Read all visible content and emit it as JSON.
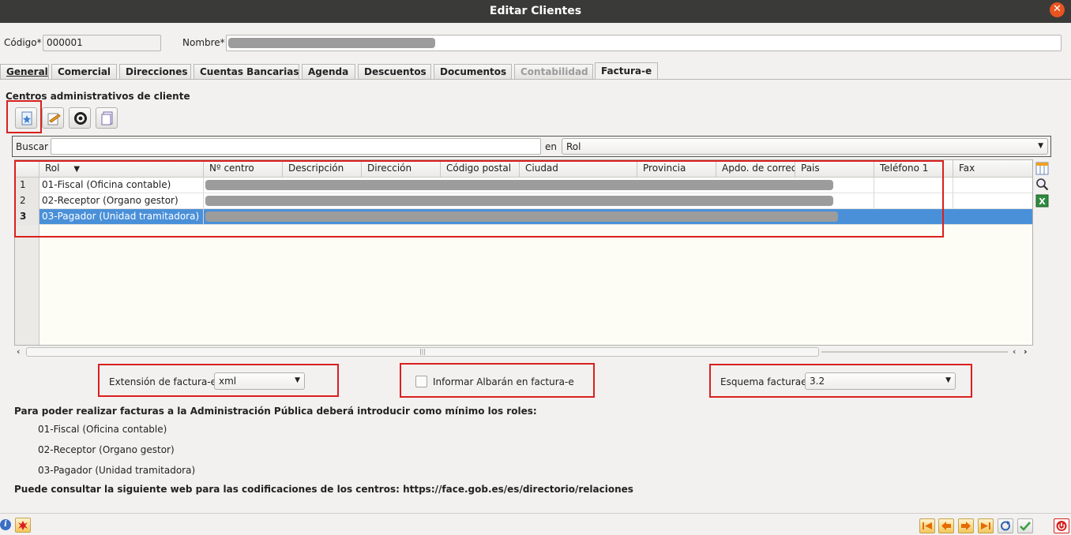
{
  "window": {
    "title": "Editar Clientes",
    "close_icon": "close-icon"
  },
  "header": {
    "codigo_label": "Código*",
    "codigo_value": "000001",
    "nombre_label": "Nombre*"
  },
  "tabs": [
    {
      "label": "General",
      "state": "normal"
    },
    {
      "label": "Comercial",
      "state": "normal"
    },
    {
      "label": "Direcciones",
      "state": "normal"
    },
    {
      "label": "Cuentas Bancarias",
      "state": "normal"
    },
    {
      "label": "Agenda",
      "state": "normal"
    },
    {
      "label": "Descuentos",
      "state": "normal"
    },
    {
      "label": "Documentos",
      "state": "normal"
    },
    {
      "label": "Contabilidad",
      "state": "disabled"
    },
    {
      "label": "Factura-e",
      "state": "active"
    }
  ],
  "section": {
    "title": "Centros administrativos de cliente"
  },
  "toolbar": {
    "icons": [
      "new-record-icon",
      "edit-record-icon",
      "delete-record-icon",
      "copy-record-icon"
    ]
  },
  "search": {
    "label": "Buscar",
    "value": "",
    "in_label": "en",
    "field_value": "Rol"
  },
  "table": {
    "columns": [
      "Rol",
      "Nº centro",
      "Descripción",
      "Dirección",
      "Código postal",
      "Ciudad",
      "Provincia",
      "Apdo. de correo",
      "Pais",
      "Teléfono 1",
      "Fax"
    ],
    "rows": [
      {
        "num": "1",
        "rol": "01-Fiscal (Oficina contable)"
      },
      {
        "num": "2",
        "rol": "02-Receptor (Organo gestor)"
      },
      {
        "num": "3",
        "rol": "03-Pagador (Unidad tramitadora)"
      }
    ],
    "selected_row": 3,
    "side_icons": [
      "configure-columns-icon",
      "search-icon",
      "excel-export-icon"
    ]
  },
  "options": {
    "extension_label": "Extensión de factura-e",
    "extension_value": "xml",
    "albaran_label": "Informar Albarán en factura-e",
    "albaran_checked": false,
    "esquema_label": "Esquema facturae",
    "esquema_value": "3.2"
  },
  "info": {
    "intro": "Para poder realizar facturas a la Administración Pública deberá introducir como mínimo los roles:",
    "roles": [
      "01-Fiscal (Oficina contable)",
      "02-Receptor (Organo gestor)",
      "03-Pagador (Unidad tramitadora)"
    ],
    "link_text": "Puede consultar la siguiente web para las codificaciones de los centros: https://face.gob.es/es/directorio/relaciones"
  },
  "footer": {
    "left_icons": [
      "info-icon",
      "bug-icon"
    ],
    "nav_icons": [
      "first-record-icon",
      "previous-record-icon",
      "next-record-icon",
      "last-record-icon",
      "refresh-icon",
      "accept-icon",
      "exit-icon"
    ]
  },
  "colors": {
    "selection": "#4a90d9",
    "highlight_box": "#d9201e",
    "titlebar": "#3a3a38"
  }
}
